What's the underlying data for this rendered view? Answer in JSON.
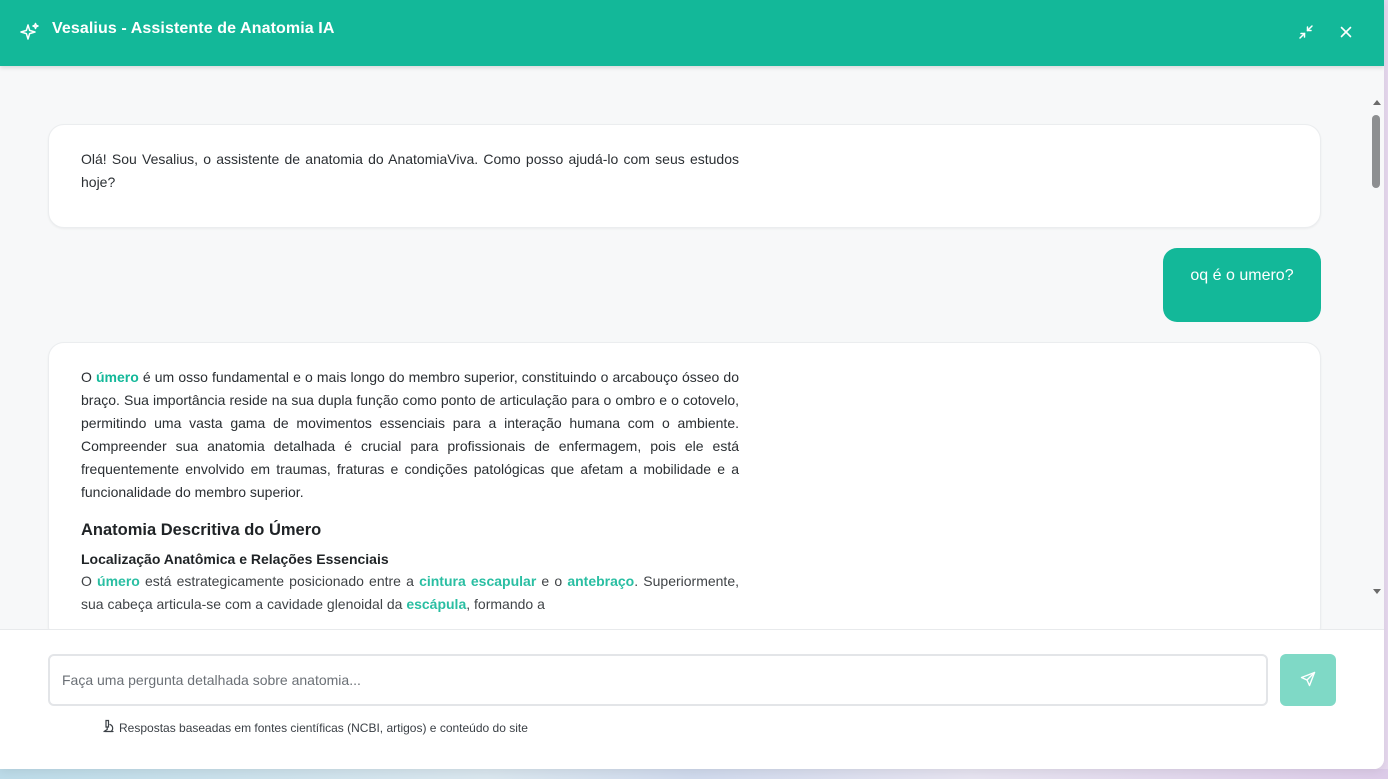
{
  "header": {
    "title": "Vesalius - Assistente de Anatomia IA",
    "logo_icon": "sparkles-icon",
    "minimize_icon": "minimize-icon",
    "close_icon": "close-icon",
    "accent_color": "#13b899"
  },
  "messages": {
    "greeting": "Olá! Sou Vesalius, o assistente de anatomia do AnatomiaViva. Como posso ajudá-lo com seus estudos hoje?",
    "user_question": "oq é o umero?",
    "answer": {
      "p1_start": "O ",
      "p1_term": "úmero",
      "p1_rest": " é um osso fundamental e o mais longo do membro superior, constituindo o arcabouço ósseo do braço. Sua importância reside na sua dupla função como ponto de articulação para o ombro e o cotovelo, permitindo uma vasta gama de movimentos essenciais para a interação humana com o ambiente. Compreender sua anatomia detalhada é crucial para profissionais de enfermagem, pois ele está frequentemente envolvido em traumas, fraturas e condições patológicas que afetam a mobilidade e a funcionalidade do membro superior.",
      "heading": "Anatomia Descritiva do Úmero",
      "subheading": "Localização Anatômica e Relações Essenciais",
      "p2_start": "O ",
      "p2_term1": "úmero",
      "p2_mid1": " está estrategicamente posicionado entre a ",
      "p2_term2": "cintura escapular",
      "p2_mid2": " e o ",
      "p2_term3": "antebraço",
      "p2_mid3": ". Superiormente, sua cabeça articula-se com a cavidade glenoidal da ",
      "p2_term4": "escápula",
      "p2_end": ", formando a"
    }
  },
  "footer": {
    "input_placeholder": "Faça uma pergunta detalhada sobre anatomia...",
    "input_value": "",
    "send_icon": "send-icon",
    "note_icon": "microscope-icon",
    "note": "Respostas baseadas em fontes científicas (NCBI, artigos) e conteúdo do site"
  }
}
